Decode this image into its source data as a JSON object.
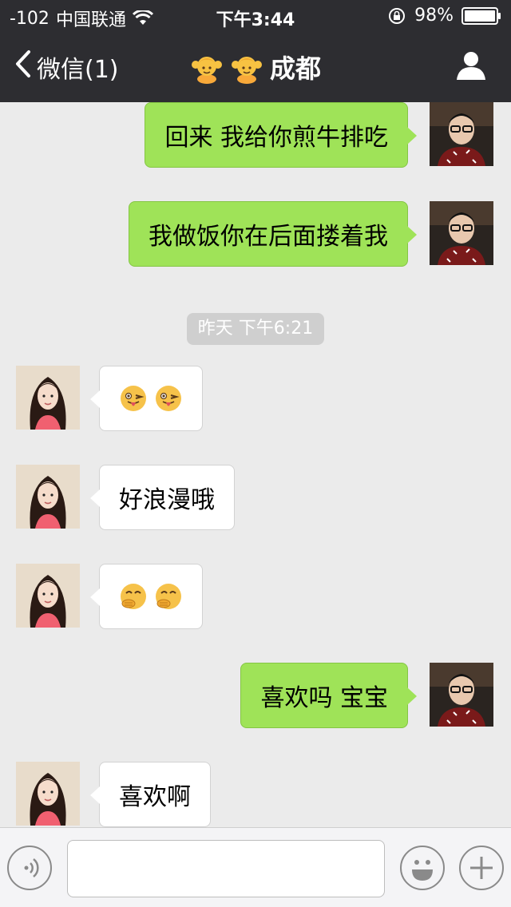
{
  "status_bar": {
    "signal": "-102",
    "carrier": "中国联通",
    "time": "下午3:44",
    "battery": "98%"
  },
  "nav": {
    "back_label": "微信(1)",
    "title": "成都",
    "title_icons": [
      "girl-emoji",
      "girl-emoji"
    ],
    "bg_color": "#2d2d31"
  },
  "messages": [
    {
      "sender": "me",
      "text": "回来 我给你煎牛排吃"
    },
    {
      "sender": "me",
      "text": "我做饭你在后面搂着我"
    },
    {
      "sender": "her",
      "text": "",
      "emojis": [
        "winking-tongue-emoji",
        "winking-tongue-emoji"
      ]
    },
    {
      "sender": "her",
      "text": "好浪漫哦"
    },
    {
      "sender": "her",
      "text": "",
      "emojis": [
        "giggle-emoji",
        "giggle-emoji"
      ]
    },
    {
      "sender": "me",
      "text": "喜欢吗 宝宝"
    },
    {
      "sender": "her",
      "text": "喜欢啊"
    }
  ],
  "timestamp": "昨天  下午6:21",
  "colors": {
    "outgoing_bubble": "#9fe358",
    "incoming_bubble": "#ffffff",
    "chat_background": "#ebebeb"
  },
  "input_bar": {
    "placeholder": "",
    "value": ""
  }
}
